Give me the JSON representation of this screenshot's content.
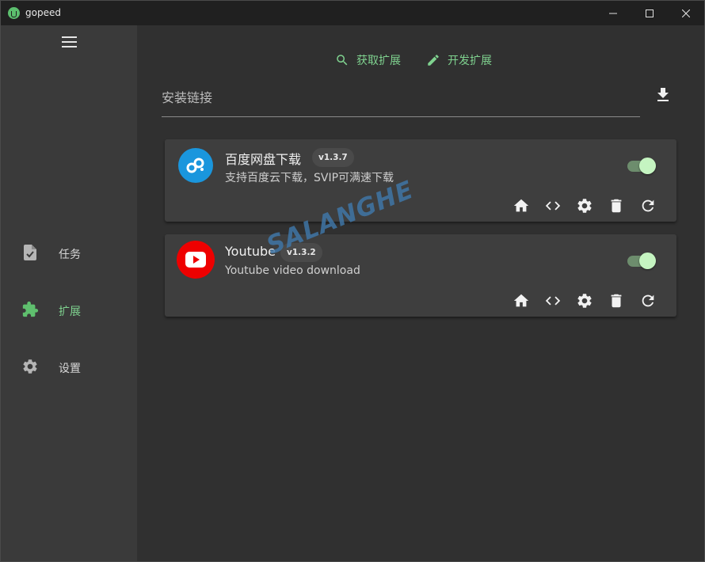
{
  "window": {
    "title": "gopeed"
  },
  "sidebar": {
    "items": [
      {
        "label": "任务",
        "icon": "task-check-icon"
      },
      {
        "label": "扩展",
        "icon": "puzzle-icon",
        "active": true
      },
      {
        "label": "设置",
        "icon": "gear-icon"
      }
    ]
  },
  "header": {
    "get_extension": "获取扩展",
    "dev_extension": "开发扩展"
  },
  "install": {
    "placeholder": "安装链接"
  },
  "extensions": [
    {
      "name": "百度网盘下载",
      "version": "v1.3.7",
      "description": "支持百度云下载，SVIP可满速下载",
      "icon": "baidu-netdisk-icon",
      "icon_color": "#1a96dd",
      "enabled": true
    },
    {
      "name": "Youtube",
      "version": "v1.3.2",
      "description": "Youtube video download",
      "icon": "youtube-icon",
      "icon_color": "#ee0000",
      "enabled": true
    }
  ],
  "watermark": "SALANGHE",
  "colors": {
    "accent": "#7fd28f",
    "toggle_thumb": "#c5f4c1"
  }
}
